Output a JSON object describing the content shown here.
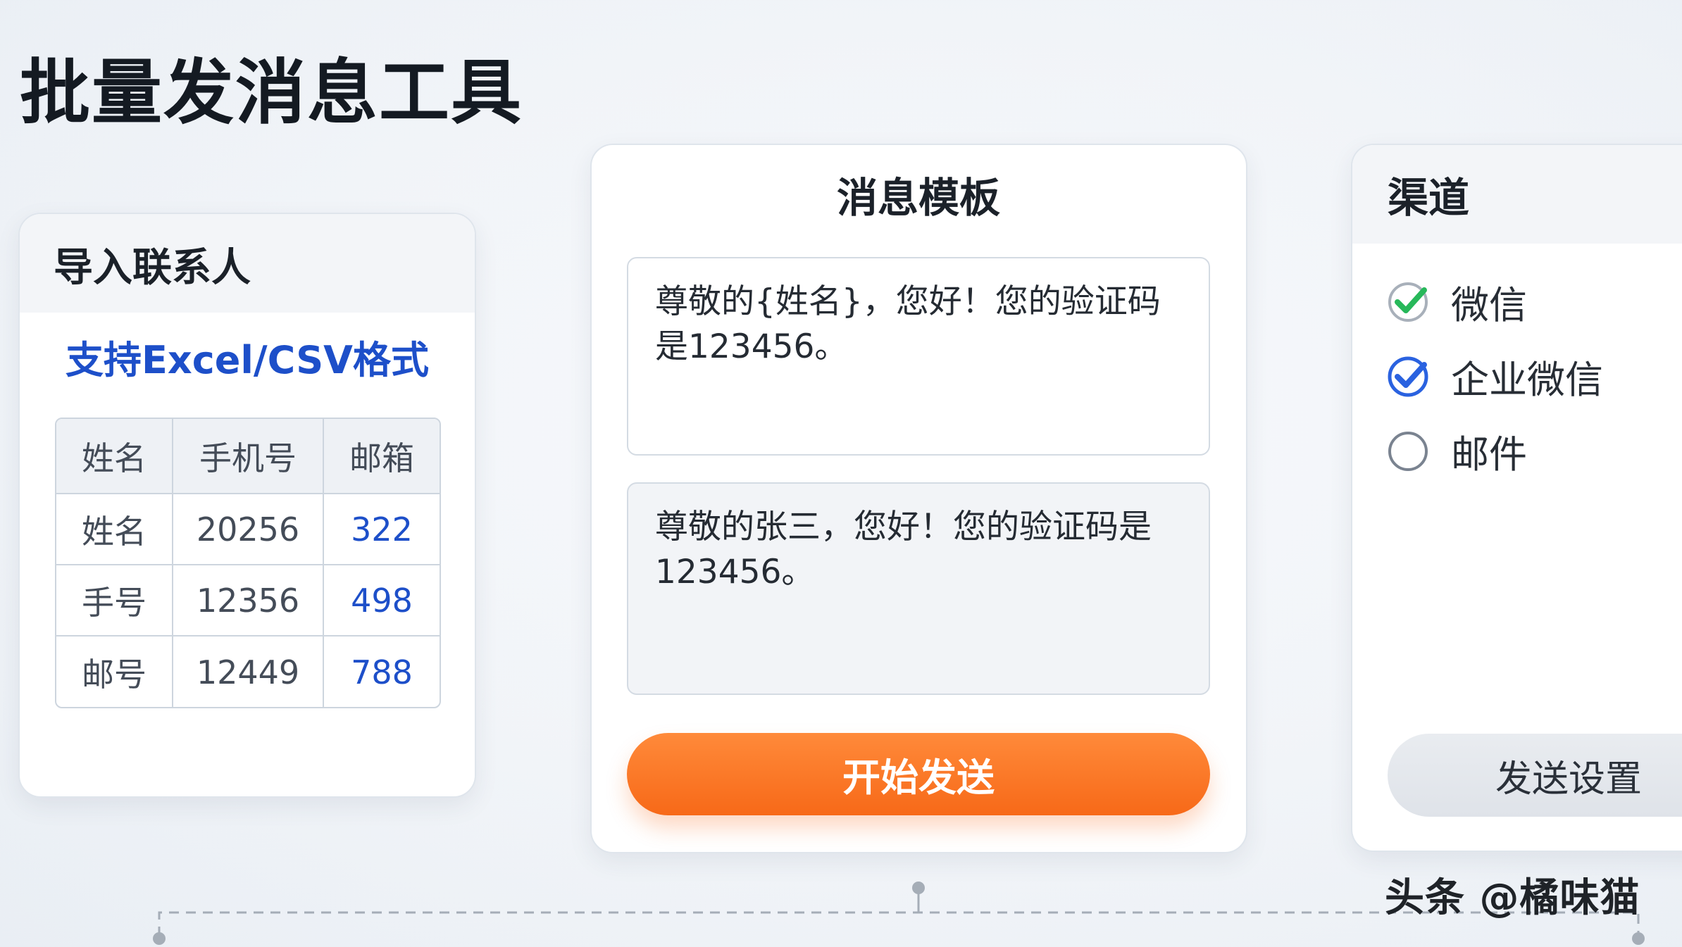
{
  "page": {
    "title": "批量发消息工具"
  },
  "import_contacts": {
    "title": "导入联系人",
    "format_note": "支持Excel/CSV格式",
    "table": {
      "headers": [
        "姓名",
        "手机号",
        "邮箱"
      ],
      "rows": [
        [
          "姓名",
          "20256",
          "322"
        ],
        [
          "手号",
          "12356",
          "498"
        ],
        [
          "邮号",
          "12449",
          "788"
        ]
      ]
    }
  },
  "message_template": {
    "title": "消息模板",
    "template_text": "尊敬的{姓名}，您好！您的验证码是123456。",
    "preview_text": "尊敬的张三，您好！您的验证码是123456。",
    "start_button": "开始发送"
  },
  "channels": {
    "title": "渠道",
    "options": [
      {
        "label": "微信",
        "state": "checked",
        "icon": "checkmark-circle-icon",
        "color": "#27b85a"
      },
      {
        "label": "企业微信",
        "state": "checked",
        "icon": "checkmark-circle-icon",
        "color": "#2a62e0"
      },
      {
        "label": "邮件",
        "state": "unchecked",
        "icon": "empty-circle-icon",
        "color": "#7a8390"
      }
    ],
    "settings_button": "发送设置"
  },
  "watermark": "头条 @橘味猫",
  "colors": {
    "accent_blue": "#1d4fc9",
    "send_orange": "#f76918",
    "check_green": "#27b85a",
    "check_blue": "#2a62e0"
  }
}
